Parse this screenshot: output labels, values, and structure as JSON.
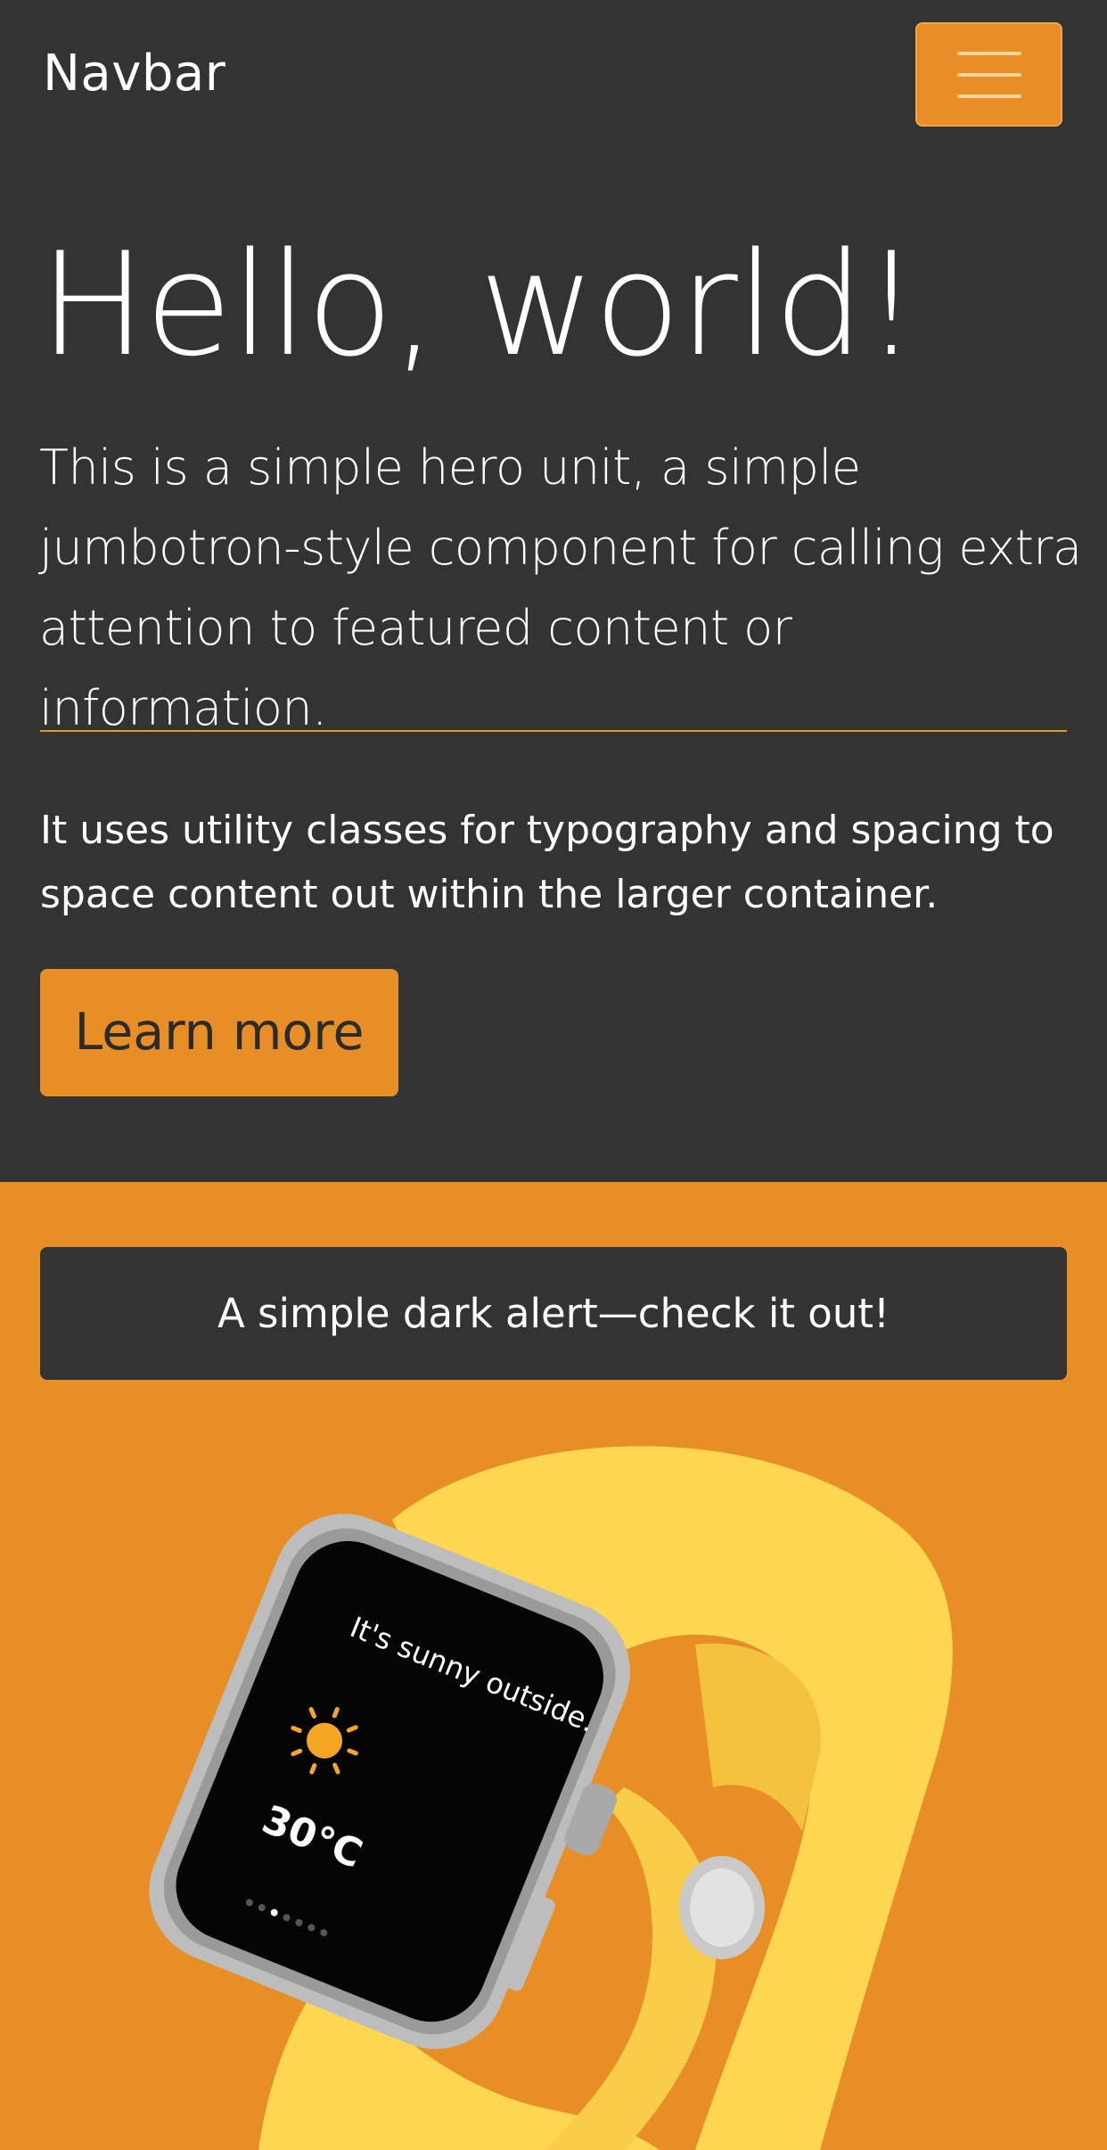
{
  "navbar": {
    "brand": "Navbar",
    "toggler_icon": "hamburger-menu-icon"
  },
  "hero": {
    "title": "Hello, world!",
    "lead": "This is a simple hero unit, a simple jumbotron-style component for calling extra attention to featured content or information.",
    "body": "It uses utility classes for typography and spacing to space content out within the larger container.",
    "button_label": "Learn more"
  },
  "alert": {
    "text": "A simple dark alert—check it out!"
  },
  "watch_screen": {
    "message": "It's sunny outside.",
    "weather_icon": "sun-icon",
    "temperature": "30°C"
  },
  "colors": {
    "dark": "#333333",
    "accent": "#e88e27",
    "rule": "#d7a028",
    "band": "#ffd45a"
  }
}
